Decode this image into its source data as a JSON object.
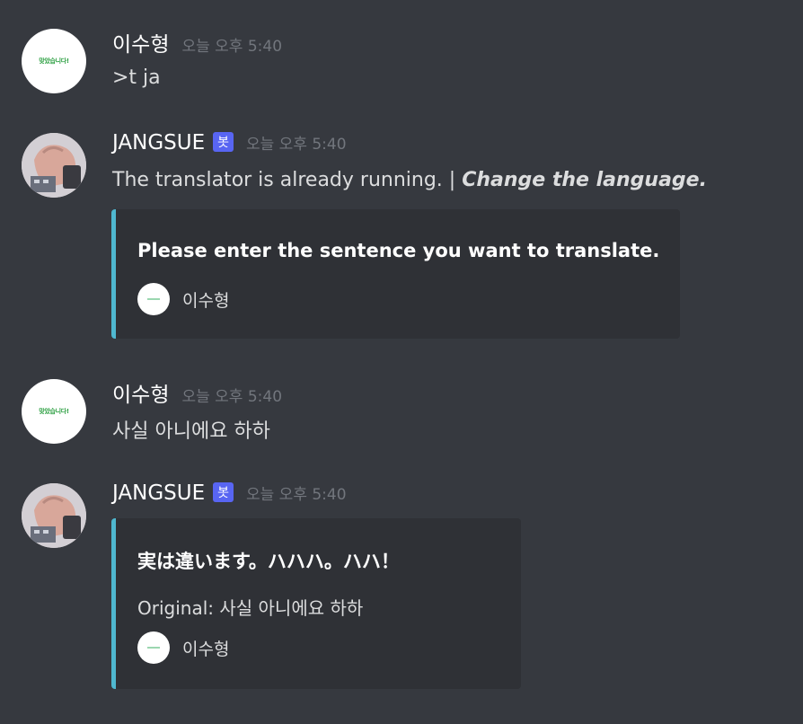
{
  "messages": [
    {
      "author": "이수형",
      "time": "오늘 오후 5:40",
      "avatar_text": "맞았습니다!",
      "text": ">t ja"
    },
    {
      "author": "JANGSUE",
      "badge": "봇",
      "time": "오늘 오후 5:40",
      "text_plain": "The translator is already running. ",
      "text_sep": "| ",
      "text_italic": "Change the language.",
      "embed": {
        "title": "Please enter the sentence you want to translate.",
        "footer": "이수형"
      }
    },
    {
      "author": "이수형",
      "time": "오늘 오후 5:40",
      "avatar_text": "맞았습니다!",
      "text": "사실 아니에요 하하"
    },
    {
      "author": "JANGSUE",
      "badge": "봇",
      "time": "오늘 오후 5:40",
      "embed": {
        "title": "実は違います。ハハハ。ハハ！",
        "desc": "Original: 사실 아니에요 하하",
        "footer": "이수형"
      }
    }
  ],
  "colors": {
    "background": "#36393f",
    "embed_bg": "#2f3136",
    "embed_accent": "#4fb8d0",
    "bot_badge": "#5865f2",
    "timestamp": "#72767d"
  }
}
